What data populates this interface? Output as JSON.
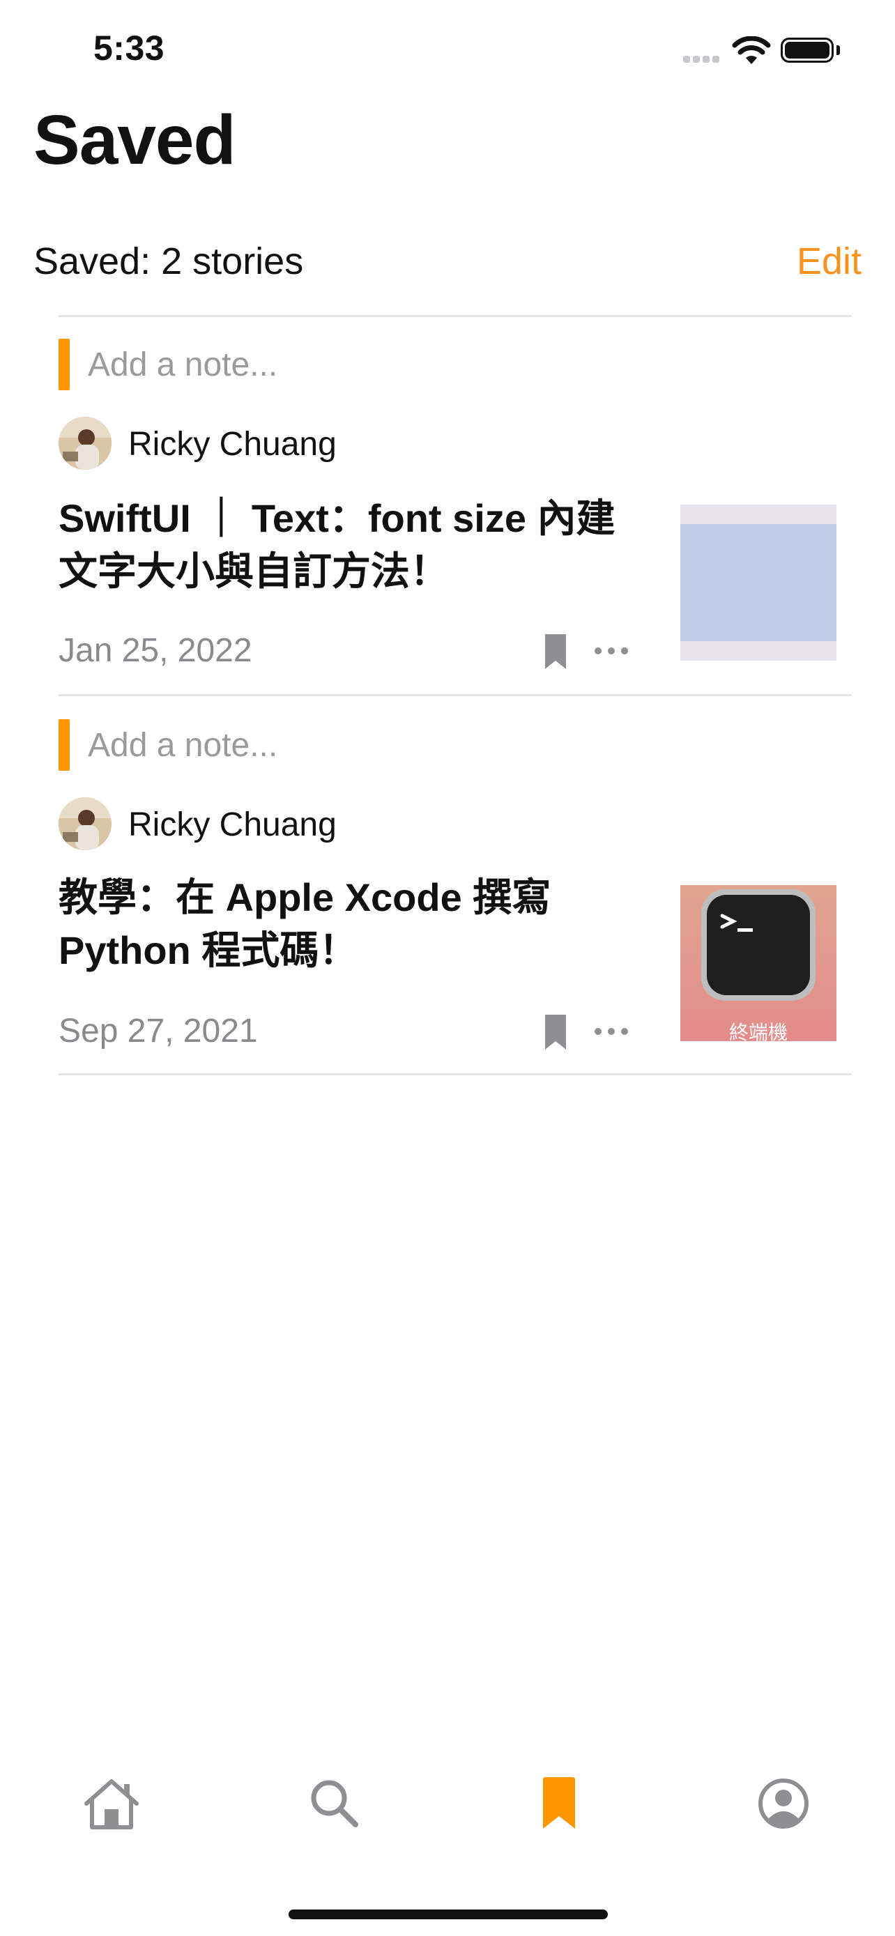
{
  "status_bar": {
    "time": "5:33"
  },
  "header": {
    "title": "Saved",
    "saved_count": "Saved: 2 stories",
    "edit_label": "Edit"
  },
  "colors": {
    "accent": "#ff9500",
    "edit": "#f7931e",
    "secondary_text": "#8a8a8e"
  },
  "stories": [
    {
      "note_placeholder": "Add a note...",
      "author": "Ricky Chuang",
      "title": "SwiftUI ｜ Text：font size 內建文字大小與自訂方法！",
      "date": "Jan 25, 2022",
      "thumbnail": "color-swatch-thumbnail"
    },
    {
      "note_placeholder": "Add a note...",
      "author": "Ricky Chuang",
      "title": "教學：在 Apple Xcode 撰寫 Python 程式碼！",
      "date": "Sep 27, 2021",
      "thumbnail": "terminal-app-thumbnail",
      "thumbnail_caption": "終端機"
    }
  ],
  "tab_bar": {
    "tabs": [
      {
        "icon": "home-icon",
        "selected": false
      },
      {
        "icon": "search-icon",
        "selected": false
      },
      {
        "icon": "bookmark-icon",
        "selected": true
      },
      {
        "icon": "profile-icon",
        "selected": false
      }
    ]
  }
}
